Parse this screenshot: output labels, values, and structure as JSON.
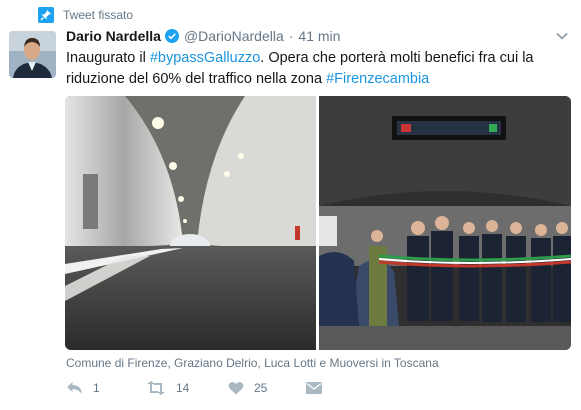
{
  "pinned": {
    "label": "Tweet fissato",
    "icon": "pin-icon"
  },
  "author": {
    "name": "Dario Nardella",
    "handle": "@DarioNardella",
    "time": "41 min",
    "verified": true
  },
  "tweet": {
    "text_part1": "Inaugurato il ",
    "hashtag1": "#bypassGalluzzo",
    "text_part2": ". Opera che porterà molti benefici fra cui la riduzione del 60% del traffico nella zona ",
    "hashtag2": "#Firenzecambia"
  },
  "media": {
    "photos": [
      {
        "description_icon": "tunnel-photo"
      },
      {
        "description_icon": "ceremony-photo"
      }
    ],
    "caption": "Comune di Firenze, Graziano Delrio, Luca Lotti e Muoversi in Toscana"
  },
  "actions": {
    "reply_count": "1",
    "retweet_count": "14",
    "like_count": "25"
  },
  "colors": {
    "accent": "#1da1f2",
    "link": "#1b95e0",
    "muted": "#657786",
    "text": "#14171a"
  }
}
